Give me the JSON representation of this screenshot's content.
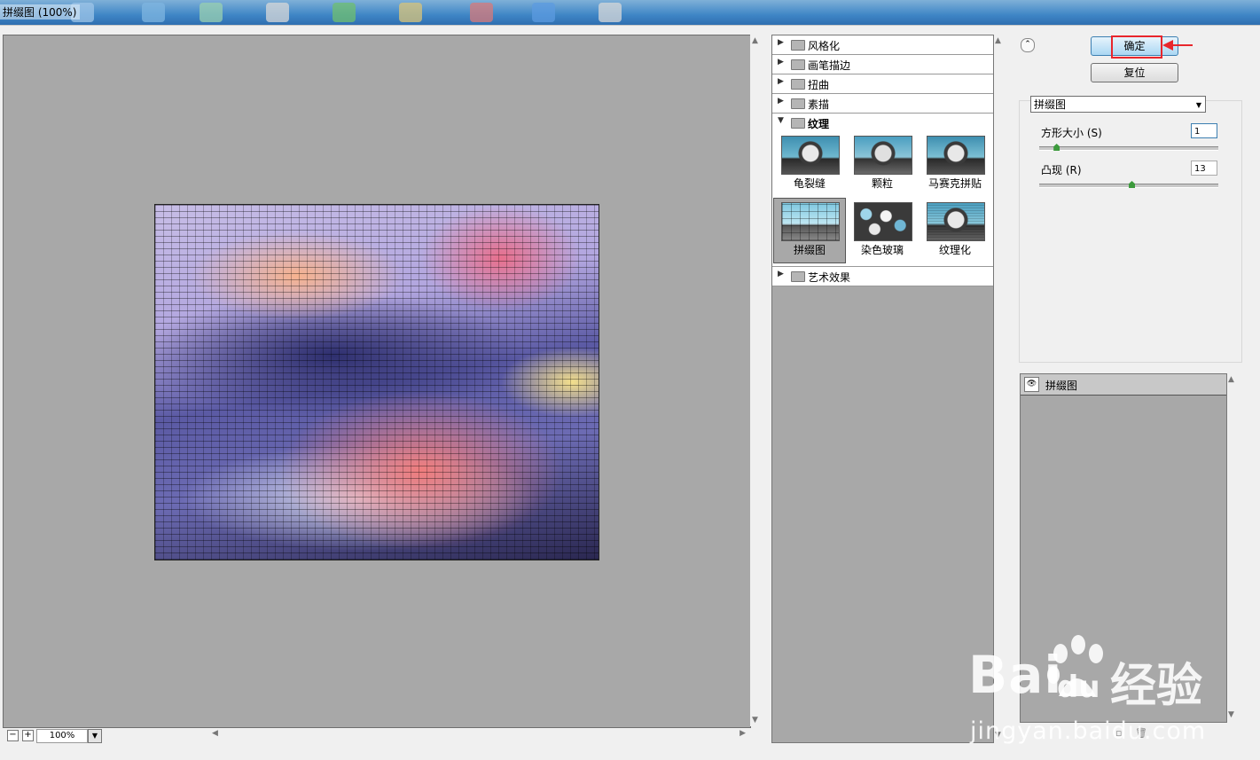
{
  "window": {
    "title": "拼缀图 (100%)"
  },
  "preview": {
    "zoom": "100%",
    "zoom_out": "−",
    "zoom_in": "+"
  },
  "gallery": {
    "categories": [
      {
        "label": "风格化",
        "expanded": false
      },
      {
        "label": "画笔描边",
        "expanded": false
      },
      {
        "label": "扭曲",
        "expanded": false
      },
      {
        "label": "素描",
        "expanded": false
      },
      {
        "label": "纹理",
        "expanded": true
      },
      {
        "label": "艺术效果",
        "expanded": false
      }
    ],
    "texture_filters": [
      {
        "label": "龟裂缝",
        "selected": false
      },
      {
        "label": "颗粒",
        "selected": false
      },
      {
        "label": "马赛克拼贴",
        "selected": false
      },
      {
        "label": "拼缀图",
        "selected": true
      },
      {
        "label": "染色玻璃",
        "selected": false
      },
      {
        "label": "纹理化",
        "selected": false
      }
    ]
  },
  "buttons": {
    "ok": "确定",
    "reset": "复位"
  },
  "settings": {
    "filter_select": "拼缀图",
    "params": [
      {
        "label": "方形大小 (S)",
        "value": "1",
        "fraction": 0.1
      },
      {
        "label": "凸现 (R)",
        "value": "13",
        "fraction": 0.52
      }
    ]
  },
  "layers": {
    "items": [
      {
        "label": "拼缀图",
        "visible": true
      }
    ]
  },
  "watermark": {
    "brand": "Bai",
    "brand2": "du",
    "text": "经验",
    "url": "jingyan.baidu.com"
  },
  "colors": {
    "highlight": "#e8262c",
    "preview_bg": "#a8a8a8",
    "ok_button": "#aad7f3"
  }
}
